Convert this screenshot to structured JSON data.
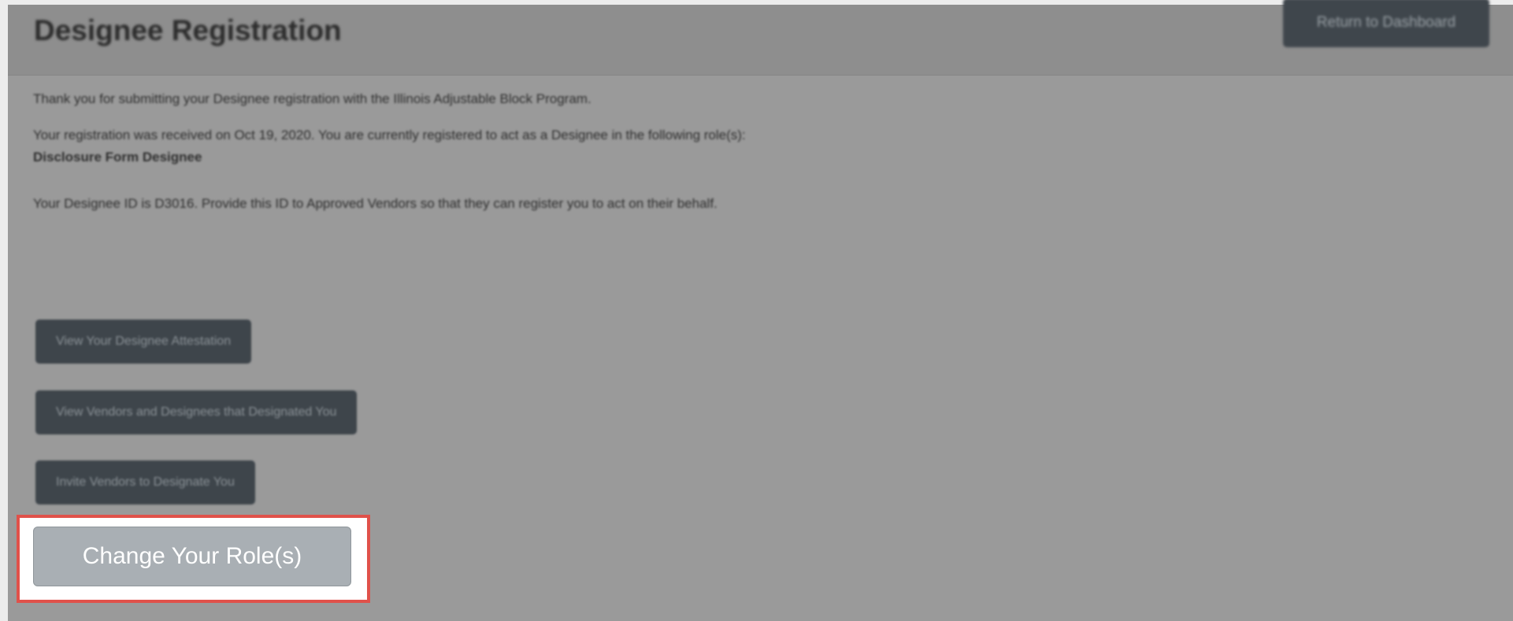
{
  "header": {
    "title": "Designee Registration",
    "return_button": "Return to Dashboard"
  },
  "content": {
    "line1": "Thank you for submitting your Designee registration with the Illinois Adjustable Block Program.",
    "line2": "Your registration was received on Oct 19, 2020. You are currently registered to act as a Designee in the following role(s):",
    "role": "Disclosure Form Designee",
    "designee_id_text": "Your Designee ID is D3016. Provide this ID to Approved Vendors so that they can register you to act on their behalf."
  },
  "buttons": {
    "view_attestation": "View Your Designee Attestation",
    "view_vendors": "View Vendors and Designees that Designated You",
    "invite_vendors": "Invite Vendors to Designate You",
    "change_roles": "Change Your Role(s)"
  },
  "colors": {
    "overlay": "#9a9a9a",
    "header": "#8e8e8e",
    "dark_button": "#3e454b",
    "highlight_border": "#e0514a",
    "highlighted_button": "#a9afb4"
  }
}
